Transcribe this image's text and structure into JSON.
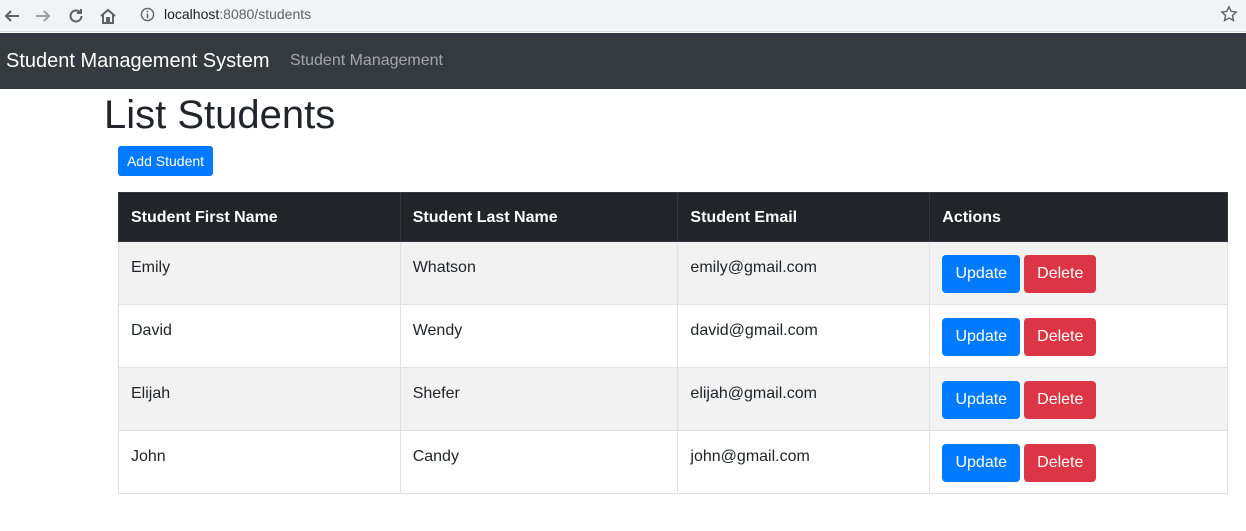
{
  "browser": {
    "url_host": "localhost",
    "url_rest": ":8080/students"
  },
  "navbar": {
    "brand": "Student Management System",
    "link": "Student Management"
  },
  "page": {
    "title": "List Students",
    "add_button": "Add Student"
  },
  "table": {
    "headers": [
      "Student First Name",
      "Student Last Name",
      "Student Email",
      "Actions"
    ],
    "rows": [
      {
        "first": "Emily",
        "last": "Whatson",
        "email": "emily@gmail.com"
      },
      {
        "first": "David",
        "last": "Wendy",
        "email": "david@gmail.com"
      },
      {
        "first": "Elijah",
        "last": "Shefer",
        "email": "elijah@gmail.com"
      },
      {
        "first": "John",
        "last": "Candy",
        "email": "john@gmail.com"
      }
    ],
    "update_label": "Update",
    "delete_label": "Delete"
  },
  "colors": {
    "navbar_bg": "#343a40",
    "primary": "#007bff",
    "danger": "#dc3545",
    "table_header_bg": "#212529"
  }
}
